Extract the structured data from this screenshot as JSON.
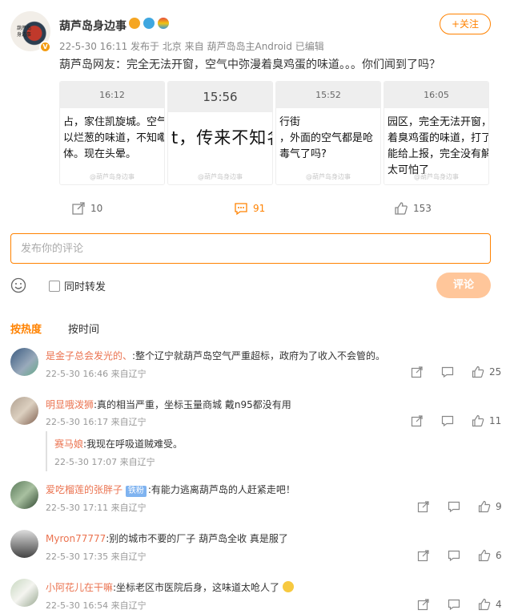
{
  "post": {
    "avatar_text": "葫芦岛身边事",
    "username": "葫芦岛身边事",
    "meta": "22-5-30 16:11  发布于 北京  来自 葫芦岛岛主Android 已编辑",
    "follow_label": "+关注",
    "text": "葫芦岛网友：完全无法开窗，空气中弥漫着臭鸡蛋的味道。。。你们闻到了吗？",
    "images": [
      {
        "time": "16:12",
        "text": "占，家住凯旋城。空气\n以烂葱的味道，不知嘞\n体。现在头晕。",
        "watermark": "@葫芦岛身边事"
      },
      {
        "time": "15:56",
        "text": "t，传来不知名",
        "watermark": "@葫芦岛身边事"
      },
      {
        "time": "15:52",
        "text": "行街\n，外面的空气都是呛\n毒气了吗?",
        "watermark": "@葫芦岛身边事"
      },
      {
        "time": "16:05",
        "text": "园区，完全无法开窗，\n着臭鸡蛋的味道，打了\n能给上报，完全没有解\n太可怕了",
        "watermark": "@葫芦岛身边事"
      }
    ],
    "reposts": "10",
    "comments": "91",
    "likes": "153"
  },
  "composer": {
    "placeholder": "发布你的评论",
    "repost_label": "同时转发",
    "submit_label": "评论"
  },
  "sort": {
    "hot_label": "按热度",
    "time_label": "按时间"
  },
  "comments": [
    {
      "name": "是金子总会发光的、",
      "text": ":整个辽宁就葫芦岛空气严重超标，政府为了收入不会管的。",
      "meta": "22-5-30 16:46 来自辽宁",
      "likes": "25"
    },
    {
      "name": "明显哦泼狮",
      "text": ":真的相当严重，坐标玉量商城 戴n95都没有用",
      "meta": "22-5-30 16:17 来自辽宁",
      "likes": "11"
    },
    {
      "name": "爱吃榴莲的张胖子",
      "badge": "铁粉",
      "text": ":有能力逃离葫芦岛的人赶紧走吧！",
      "meta": "22-5-30 17:11 来自辽宁",
      "likes": "9"
    },
    {
      "name": "Myron77777",
      "text": ":别的城市不要的厂子 葫芦岛全收 真是服了",
      "meta": "22-5-30 17:35 来自辽宁",
      "likes": "6"
    },
    {
      "name": "小阿花儿在干嘛",
      "text": ":坐标老区市医院后身，这味道太呛人了",
      "meta": "22-5-30 16:54 来自辽宁",
      "likes": "4"
    }
  ],
  "reply": {
    "name": "赛马娘",
    "text": ":我现在呼吸道贼难受。",
    "meta": "22-5-30 17:07 来自辽宁"
  },
  "colors": {
    "accent": "#ff8200",
    "name": "#eb7350",
    "submit_disabled": "#ffc69a"
  }
}
